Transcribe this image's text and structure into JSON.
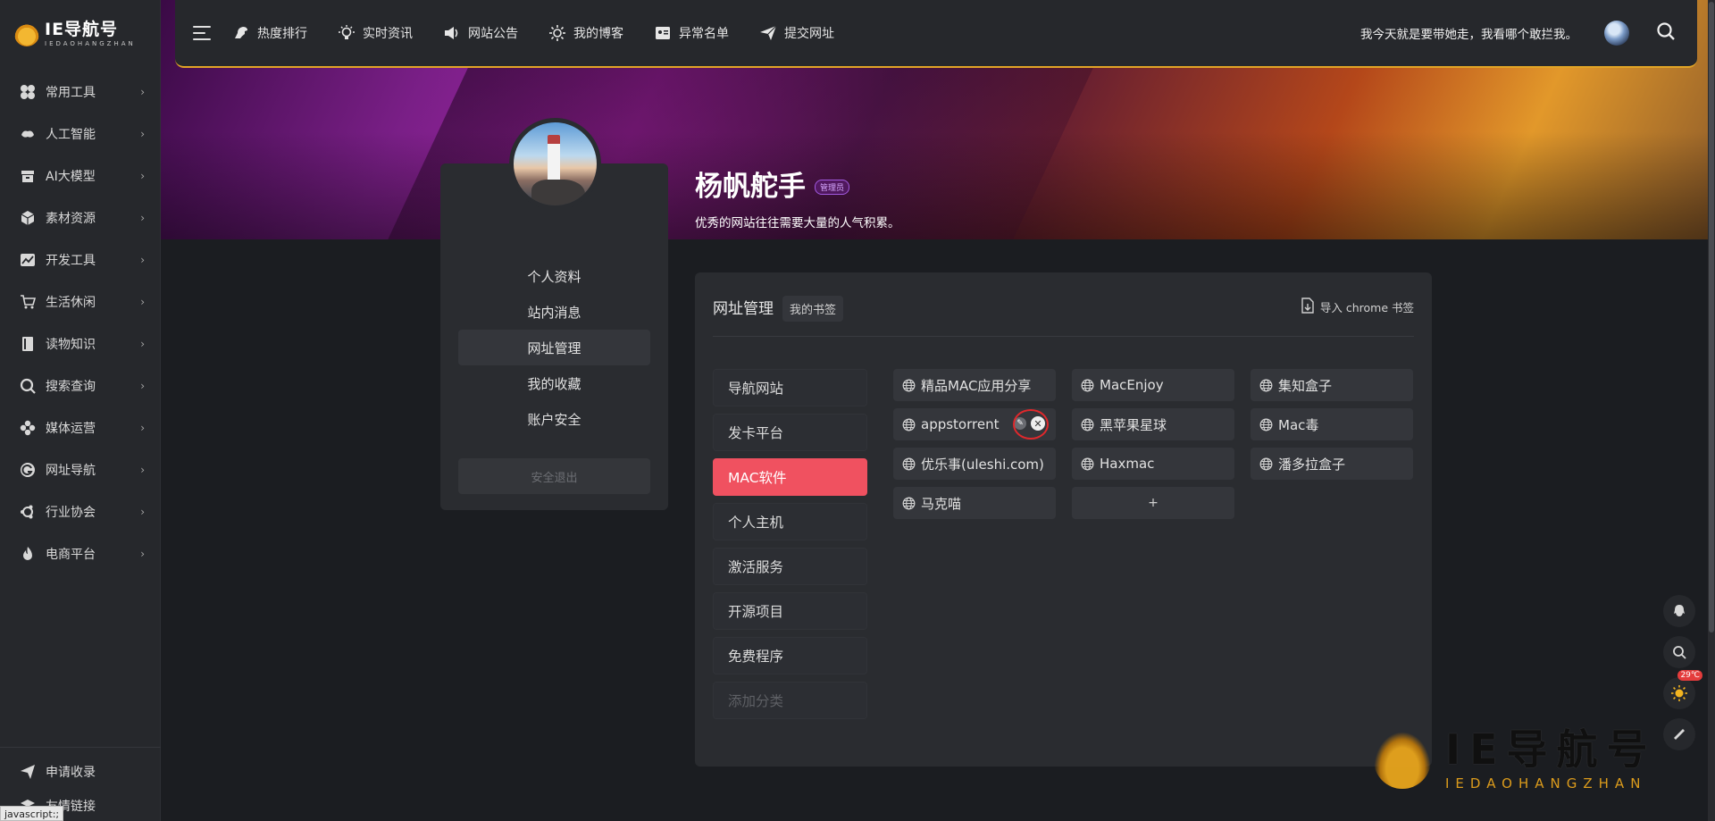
{
  "sidebar": {
    "logo_main": "IE导航号",
    "logo_sub": "IEDAOHANGZHAN",
    "items": [
      {
        "label": "常用工具",
        "icon": "grid-icon"
      },
      {
        "label": "人工智能",
        "icon": "brain-icon"
      },
      {
        "label": "AI大模型",
        "icon": "box-icon"
      },
      {
        "label": "素材资源",
        "icon": "cube-icon"
      },
      {
        "label": "开发工具",
        "icon": "chart-icon"
      },
      {
        "label": "生活休闲",
        "icon": "cart-icon"
      },
      {
        "label": "读物知识",
        "icon": "book-icon"
      },
      {
        "label": "搜索查询",
        "icon": "search-icon"
      },
      {
        "label": "媒体运营",
        "icon": "flower-icon"
      },
      {
        "label": "网址导航",
        "icon": "g-icon"
      },
      {
        "label": "行业协会",
        "icon": "ubuntu-icon"
      },
      {
        "label": "电商平台",
        "icon": "fire-icon"
      }
    ],
    "bottom_items": [
      {
        "label": "申请收录",
        "icon": "send-icon"
      },
      {
        "label": "友情链接",
        "icon": "layers-icon"
      }
    ],
    "status_hint": "javascript:;"
  },
  "topbar": {
    "nav": [
      {
        "label": "热度排行",
        "icon": "dinosaur-icon"
      },
      {
        "label": "实时资讯",
        "icon": "bulb-icon"
      },
      {
        "label": "网站公告",
        "icon": "speaker-icon"
      },
      {
        "label": "我的博客",
        "icon": "sun-icon"
      },
      {
        "label": "异常名单",
        "icon": "id-card-icon"
      },
      {
        "label": "提交网址",
        "icon": "paper-plane-icon"
      }
    ],
    "quote": "我今天就是要带她走，我看哪个敢拦我。"
  },
  "profile": {
    "username": "杨帆舵手",
    "role": "管理员",
    "motto": "优秀的网站往往需要大量的人气积累。",
    "menu": [
      {
        "label": "个人资料",
        "active": false
      },
      {
        "label": "站内消息",
        "active": false
      },
      {
        "label": "网址管理",
        "active": true
      },
      {
        "label": "我的收藏",
        "active": false
      },
      {
        "label": "账户安全",
        "active": false
      }
    ],
    "logout_label": "安全退出"
  },
  "manager": {
    "title": "网址管理",
    "tag": "我的书签",
    "import_label": "导入 chrome 书签",
    "categories": [
      {
        "label": "导航网站",
        "active": false
      },
      {
        "label": "发卡平台",
        "active": false
      },
      {
        "label": "MAC软件",
        "active": true
      },
      {
        "label": "个人主机",
        "active": false
      },
      {
        "label": "激活服务",
        "active": false
      },
      {
        "label": "开源项目",
        "active": false
      },
      {
        "label": "免费程序",
        "active": false
      }
    ],
    "add_category_placeholder": "添加分类",
    "sites": [
      "精品MAC应用分享",
      "MacEnjoy",
      "集知盒子",
      "appstorrent",
      "黑苹果星球",
      "Mac毒",
      "优乐事(uleshi.com)",
      "Haxmac",
      "潘多拉盒子",
      "马克喵"
    ],
    "add_site_label": "+"
  },
  "float_tools": {
    "temperature": "29℃"
  },
  "watermark": {
    "main": "IE导航号",
    "sub": "IEDAOHANGZHAN"
  },
  "colors": {
    "accent": "#f05160",
    "topbar_border": "#e1a526",
    "panel": "#2a2c30",
    "sidebar": "#26282c"
  }
}
